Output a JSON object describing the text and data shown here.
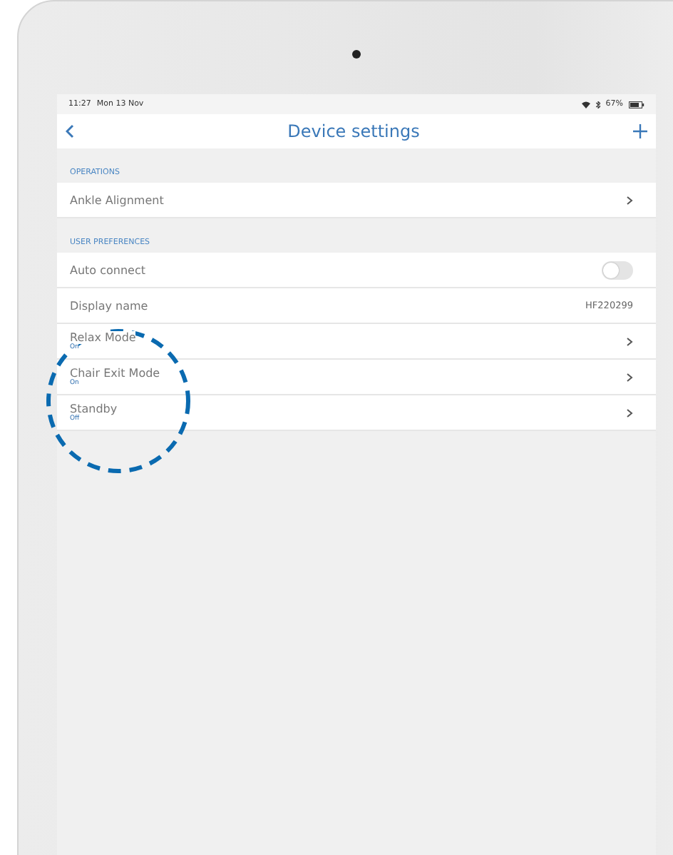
{
  "status_bar": {
    "time": "11:27",
    "date": "Mon 13 Nov",
    "battery": "67%"
  },
  "nav_bar": {
    "title": "Device settings"
  },
  "sections": [
    {
      "header": "OPERATIONS",
      "rows": [
        {
          "kind": "link",
          "label": "Ankle Alignment"
        }
      ]
    },
    {
      "header": "USER PREFERENCES",
      "rows": [
        {
          "kind": "toggle",
          "label": "Auto connect",
          "on": false
        },
        {
          "kind": "value",
          "label": "Display name",
          "value": "HF220299"
        },
        {
          "kind": "link",
          "label": "Relax Mode",
          "subtitle": "On"
        },
        {
          "kind": "link",
          "label": "Chair Exit Mode",
          "subtitle": "On"
        },
        {
          "kind": "link",
          "label": "Standby",
          "subtitle": "Off"
        }
      ]
    }
  ],
  "highlight": {
    "kind": "dashed-circle"
  }
}
